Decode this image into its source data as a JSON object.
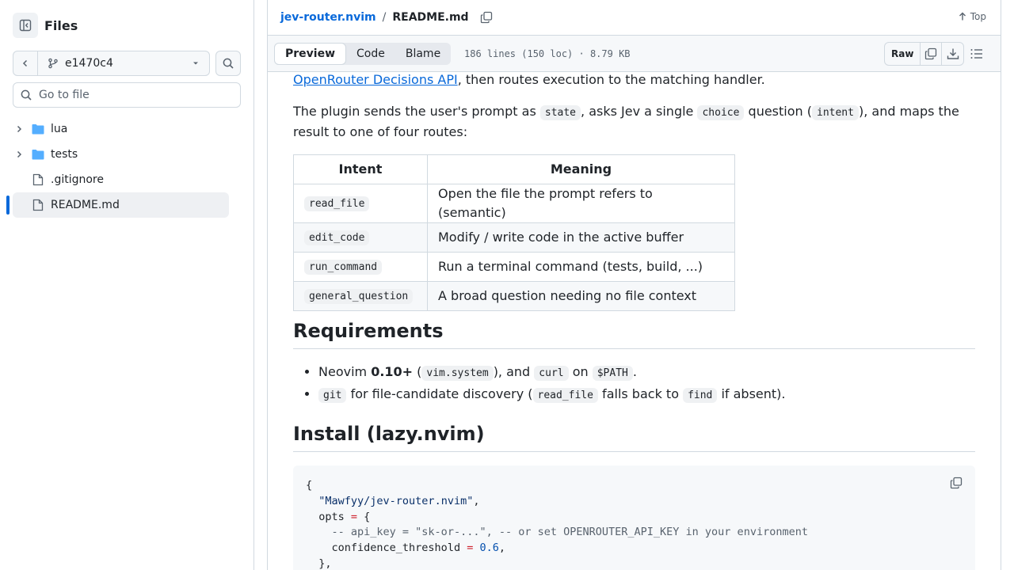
{
  "sidebar": {
    "title": "Files",
    "branch": "e1470c4",
    "goto_placeholder": "Go to file",
    "tree": [
      {
        "label": "lua",
        "kind": "folder"
      },
      {
        "label": "tests",
        "kind": "folder"
      },
      {
        "label": ".gitignore",
        "kind": "file"
      },
      {
        "label": "README.md",
        "kind": "file",
        "active": true
      }
    ]
  },
  "breadcrumb": {
    "repo": "jev-router.nvim",
    "separator": "/",
    "file": "README.md"
  },
  "top_link": "Top",
  "filebar": {
    "tabs": [
      "Preview",
      "Code",
      "Blame"
    ],
    "selected_tab": "Preview",
    "meta": "186 lines (150 loc) · 8.79 KB",
    "raw": "Raw"
  },
  "readme": {
    "p1_link": "OpenRouter Decisions API",
    "p1_rest": ", then routes execution to the matching handler.",
    "p2": {
      "t1": "The plugin sends the user's prompt as ",
      "c1": "state",
      "t2": ", asks Jev a single ",
      "c2": "choice",
      "t3": " question (",
      "c3": "intent",
      "t4": "), and maps the result to one of four routes:"
    },
    "table": {
      "headers": [
        "Intent",
        "Meaning"
      ],
      "rows": [
        {
          "intent": "read_file",
          "meaning": "Open the file the prompt refers to (semantic)"
        },
        {
          "intent": "edit_code",
          "meaning": "Modify / write code in the active buffer"
        },
        {
          "intent": "run_command",
          "meaning": "Run a terminal command (tests, build, ...)"
        },
        {
          "intent": "general_question",
          "meaning": "A broad question needing no file context"
        }
      ]
    },
    "requirements": {
      "heading": "Requirements",
      "li1": {
        "t1": "Neovim ",
        "b1": "0.10+",
        "t2": " (",
        "c1": "vim.system",
        "t3": "), and ",
        "c2": "curl",
        "t4": " on ",
        "c3": "$PATH",
        "t5": "."
      },
      "li2": {
        "c1": "git",
        "t1": " for file-candidate discovery (",
        "c2": "read_file",
        "t2": " falls back to ",
        "c3": "find",
        "t3": " if absent)."
      }
    },
    "install": {
      "heading": "Install (lazy.nvim)",
      "code": {
        "l1": "{",
        "l2_str": "\"Mawfyy/jev-router.nvim\"",
        "l2_rest": ",",
        "l3_key": "opts ",
        "l3_op": "=",
        "l3_rest": " {",
        "l4_cmt": "-- api_key = \"sk-or-...\", -- or set OPENROUTER_API_KEY in your environment",
        "l5_key": "confidence_threshold ",
        "l5_op": "=",
        "l5_num": " 0.6",
        "l5_rest": ",",
        "l6": "},"
      }
    }
  },
  "colors": {
    "accent": "#0969da",
    "border": "#d1d9e0",
    "folder": "#54aeff"
  }
}
